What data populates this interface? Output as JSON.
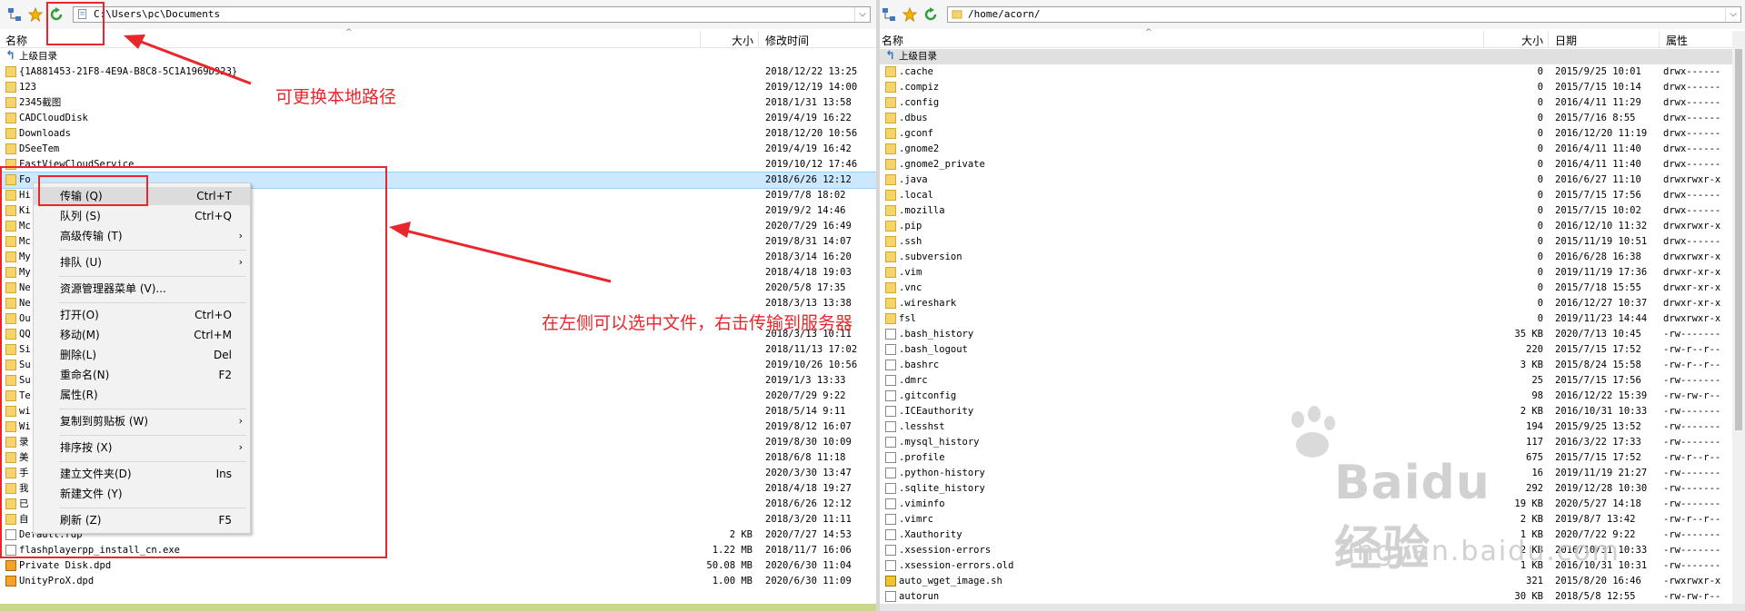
{
  "left": {
    "path": "C:\\Users\\pc\\Documents",
    "columns": {
      "name": "名称",
      "size": "大小",
      "date": "修改时间"
    },
    "rows": [
      {
        "name": "上级目录",
        "size": "",
        "date": "",
        "icon": "up"
      },
      {
        "name": "{1A881453-21F8-4E9A-B8C8-5C1A1969D923}",
        "size": "",
        "date": "2018/12/22 13:25",
        "icon": "folder"
      },
      {
        "name": "123",
        "size": "",
        "date": "2019/12/19 14:00",
        "icon": "folder"
      },
      {
        "name": "2345截图",
        "size": "",
        "date": "2018/1/31 13:58",
        "icon": "folder"
      },
      {
        "name": "CADCloudDisk",
        "size": "",
        "date": "2019/4/19 16:22",
        "icon": "folder"
      },
      {
        "name": "Downloads",
        "size": "",
        "date": "2018/12/20 10:56",
        "icon": "folder"
      },
      {
        "name": "DSeeTem",
        "size": "",
        "date": "2019/4/19 16:42",
        "icon": "folder"
      },
      {
        "name": "FastViewCloudService",
        "size": "",
        "date": "2019/10/12 17:46",
        "icon": "folder"
      },
      {
        "name": "Fo",
        "size": "",
        "date": "2018/6/26 12:12",
        "icon": "folder",
        "selected": true
      },
      {
        "name": "Hi",
        "size": "",
        "date": "2019/7/8 18:02",
        "icon": "folder"
      },
      {
        "name": "Ki",
        "size": "",
        "date": "2019/9/2 14:46",
        "icon": "folder"
      },
      {
        "name": "Mc",
        "size": "",
        "date": "2020/7/29 16:49",
        "icon": "folder"
      },
      {
        "name": "Mc",
        "size": "",
        "date": "2019/8/31 14:07",
        "icon": "folder"
      },
      {
        "name": "My",
        "size": "",
        "date": "2018/3/14 16:20",
        "icon": "folder"
      },
      {
        "name": "My",
        "size": "",
        "date": "2018/4/18 19:03",
        "icon": "folder"
      },
      {
        "name": "Ne",
        "size": "",
        "date": "2020/5/8 17:35",
        "icon": "folder"
      },
      {
        "name": "Ne",
        "size": "",
        "date": "2018/3/13 13:38",
        "icon": "folder"
      },
      {
        "name": "Ou",
        "size": "",
        "date": "",
        "icon": "folder"
      },
      {
        "name": "QQ",
        "size": "",
        "date": "2018/3/13 10:11",
        "icon": "folder"
      },
      {
        "name": "Si",
        "size": "",
        "date": "2018/11/13 17:02",
        "icon": "folder"
      },
      {
        "name": "Su",
        "size": "",
        "date": "2019/10/26 10:56",
        "icon": "folder"
      },
      {
        "name": "Su",
        "size": "",
        "date": "2019/1/3 13:33",
        "icon": "folder"
      },
      {
        "name": "Te",
        "size": "",
        "date": "2020/7/29 9:22",
        "icon": "folder"
      },
      {
        "name": "wi",
        "size": "",
        "date": "2018/5/14 9:11",
        "icon": "folder"
      },
      {
        "name": "Wi",
        "size": "",
        "date": "2019/8/12 16:07",
        "icon": "folder"
      },
      {
        "name": "录",
        "size": "",
        "date": "2019/8/30 10:09",
        "icon": "folder"
      },
      {
        "name": "美",
        "size": "",
        "date": "2018/6/8 11:18",
        "icon": "folder"
      },
      {
        "name": "手",
        "size": "",
        "date": "2020/3/30 13:47",
        "icon": "folder"
      },
      {
        "name": "我",
        "size": "",
        "date": "2018/4/18 19:27",
        "icon": "folder"
      },
      {
        "name": "已",
        "size": "",
        "date": "2018/6/26 12:12",
        "icon": "folder"
      },
      {
        "name": "自",
        "size": "",
        "date": "2018/3/20 11:11",
        "icon": "folder"
      },
      {
        "name": "Default.rdp",
        "size": "2 KB",
        "date": "2020/7/27 14:53",
        "icon": "file"
      },
      {
        "name": "flashplayerpp_install_cn.exe",
        "size": "1.22 MB",
        "date": "2018/11/7 16:06",
        "icon": "file"
      },
      {
        "name": "Private Disk.dpd",
        "size": "50.08 MB",
        "date": "2020/6/30 11:04",
        "icon": "dpd"
      },
      {
        "name": "UnityProX.dpd",
        "size": "1.00 MB",
        "date": "2020/6/30 11:09",
        "icon": "dpd"
      }
    ]
  },
  "right": {
    "path": "/home/acorn/",
    "columns": {
      "name": "名称",
      "size": "大小",
      "date": "日期",
      "attr": "属性"
    },
    "rows": [
      {
        "name": "上级目录",
        "size": "",
        "date": "",
        "attr": "",
        "icon": "up"
      },
      {
        "name": ".cache",
        "size": "0",
        "date": "2015/9/25 10:01",
        "attr": "drwx------",
        "icon": "folder"
      },
      {
        "name": ".compiz",
        "size": "0",
        "date": "2015/7/15 10:14",
        "attr": "drwx------",
        "icon": "folder"
      },
      {
        "name": ".config",
        "size": "0",
        "date": "2016/4/11 11:29",
        "attr": "drwx------",
        "icon": "folder"
      },
      {
        "name": ".dbus",
        "size": "0",
        "date": "2015/7/16 8:55",
        "attr": "drwx------",
        "icon": "folder"
      },
      {
        "name": ".gconf",
        "size": "0",
        "date": "2016/12/20 11:19",
        "attr": "drwx------",
        "icon": "folder"
      },
      {
        "name": ".gnome2",
        "size": "0",
        "date": "2016/4/11 11:40",
        "attr": "drwx------",
        "icon": "folder"
      },
      {
        "name": ".gnome2_private",
        "size": "0",
        "date": "2016/4/11 11:40",
        "attr": "drwx------",
        "icon": "folder"
      },
      {
        "name": ".java",
        "size": "0",
        "date": "2016/6/27 11:10",
        "attr": "drwxrwxr-x",
        "icon": "folder"
      },
      {
        "name": ".local",
        "size": "0",
        "date": "2015/7/15 17:56",
        "attr": "drwx------",
        "icon": "folder"
      },
      {
        "name": ".mozilla",
        "size": "0",
        "date": "2015/7/15 10:02",
        "attr": "drwx------",
        "icon": "folder"
      },
      {
        "name": ".pip",
        "size": "0",
        "date": "2016/12/10 11:32",
        "attr": "drwxrwxr-x",
        "icon": "folder"
      },
      {
        "name": ".ssh",
        "size": "0",
        "date": "2015/11/19 10:51",
        "attr": "drwx------",
        "icon": "folder"
      },
      {
        "name": ".subversion",
        "size": "0",
        "date": "2016/6/28 16:38",
        "attr": "drwxrwxr-x",
        "icon": "folder"
      },
      {
        "name": ".vim",
        "size": "0",
        "date": "2019/11/19 17:36",
        "attr": "drwxr-xr-x",
        "icon": "folder"
      },
      {
        "name": ".vnc",
        "size": "0",
        "date": "2015/7/18 15:55",
        "attr": "drwxr-xr-x",
        "icon": "folder"
      },
      {
        "name": ".wireshark",
        "size": "0",
        "date": "2016/12/27 10:37",
        "attr": "drwxr-xr-x",
        "icon": "folder"
      },
      {
        "name": "fsl",
        "size": "0",
        "date": "2019/11/23 14:44",
        "attr": "drwxrwxr-x",
        "icon": "folder"
      },
      {
        "name": ".bash_history",
        "size": "35 KB",
        "date": "2020/7/13 10:45",
        "attr": "-rw-------",
        "icon": "file"
      },
      {
        "name": ".bash_logout",
        "size": "220",
        "date": "2015/7/15 17:52",
        "attr": "-rw-r--r--",
        "icon": "file"
      },
      {
        "name": ".bashrc",
        "size": "3 KB",
        "date": "2015/8/24 15:58",
        "attr": "-rw-r--r--",
        "icon": "file"
      },
      {
        "name": ".dmrc",
        "size": "25",
        "date": "2015/7/15 17:56",
        "attr": "-rw-------",
        "icon": "file"
      },
      {
        "name": ".gitconfig",
        "size": "98",
        "date": "2016/12/22 15:39",
        "attr": "-rw-rw-r--",
        "icon": "file"
      },
      {
        "name": ".ICEauthority",
        "size": "2 KB",
        "date": "2016/10/31 10:33",
        "attr": "-rw-------",
        "icon": "file"
      },
      {
        "name": ".lesshst",
        "size": "194",
        "date": "2015/9/25 13:52",
        "attr": "-rw-------",
        "icon": "file"
      },
      {
        "name": ".mysql_history",
        "size": "117",
        "date": "2016/3/22 17:33",
        "attr": "-rw-------",
        "icon": "file"
      },
      {
        "name": ".profile",
        "size": "675",
        "date": "2015/7/15 17:52",
        "attr": "-rw-r--r--",
        "icon": "file"
      },
      {
        "name": ".python-history",
        "size": "16",
        "date": "2019/11/19 21:27",
        "attr": "-rw-------",
        "icon": "file"
      },
      {
        "name": ".sqlite_history",
        "size": "292",
        "date": "2019/12/28 10:30",
        "attr": "-rw-------",
        "icon": "file"
      },
      {
        "name": ".viminfo",
        "size": "19 KB",
        "date": "2020/5/27 14:18",
        "attr": "-rw-------",
        "icon": "file"
      },
      {
        "name": ".vimrc",
        "size": "2 KB",
        "date": "2019/8/7 13:42",
        "attr": "-rw-r--r--",
        "icon": "file"
      },
      {
        "name": ".Xauthority",
        "size": "1 KB",
        "date": "2020/7/22 9:22",
        "attr": "-rw-------",
        "icon": "file"
      },
      {
        "name": ".xsession-errors",
        "size": "2 KB",
        "date": "2016/10/31 10:33",
        "attr": "-rw-------",
        "icon": "file"
      },
      {
        "name": ".xsession-errors.old",
        "size": "1 KB",
        "date": "2016/10/31 10:31",
        "attr": "-rw-------",
        "icon": "file"
      },
      {
        "name": "auto_wget_image.sh",
        "size": "321",
        "date": "2015/8/20 16:46",
        "attr": "-rwxrwxr-x",
        "icon": "sh"
      },
      {
        "name": "autorun",
        "size": "30 KB",
        "date": "2018/5/8 12:55",
        "attr": "-rw-rw-r--",
        "icon": "file"
      }
    ]
  },
  "context_menu": [
    {
      "label": "传输 (Q)",
      "shortcut": "Ctrl+T",
      "submenu": false
    },
    {
      "label": "队列 (S)",
      "shortcut": "Ctrl+Q",
      "submenu": false
    },
    {
      "label": "高级传输 (T)",
      "shortcut": "",
      "submenu": true
    },
    {
      "sep": true
    },
    {
      "label": "排队 (U)",
      "shortcut": "",
      "submenu": true
    },
    {
      "sep": true
    },
    {
      "label": "资源管理器菜单 (V)...",
      "shortcut": "",
      "submenu": false
    },
    {
      "sep": true
    },
    {
      "label": "打开(O)",
      "shortcut": "Ctrl+O",
      "submenu": false
    },
    {
      "label": "移动(M)",
      "shortcut": "Ctrl+M",
      "submenu": false
    },
    {
      "label": "删除(L)",
      "shortcut": "Del",
      "submenu": false
    },
    {
      "label": "重命名(N)",
      "shortcut": "F2",
      "submenu": false
    },
    {
      "label": "属性(R)",
      "shortcut": "",
      "submenu": false
    },
    {
      "sep": true
    },
    {
      "label": "复制到剪贴板 (W)",
      "shortcut": "",
      "submenu": true
    },
    {
      "sep": true
    },
    {
      "label": "排序按 (X)",
      "shortcut": "",
      "submenu": true
    },
    {
      "sep": true
    },
    {
      "label": "建立文件夹(D)",
      "shortcut": "Ins",
      "submenu": false
    },
    {
      "label": "新建文件 (Y)",
      "shortcut": "",
      "submenu": false
    },
    {
      "sep": true
    },
    {
      "label": "刷新 (Z)",
      "shortcut": "F5",
      "submenu": false
    }
  ],
  "annotations": {
    "change_path": "可更换本地路径",
    "transfer_hint": "在左侧可以选中文件，右击传输到服务器"
  },
  "watermark": {
    "brand": "Baidu经验",
    "site": "jingyan.baidu.com"
  },
  "colors": {
    "annotation": "#e8262b",
    "selection": "#cce8ff",
    "status_left": "#c9d78a"
  }
}
